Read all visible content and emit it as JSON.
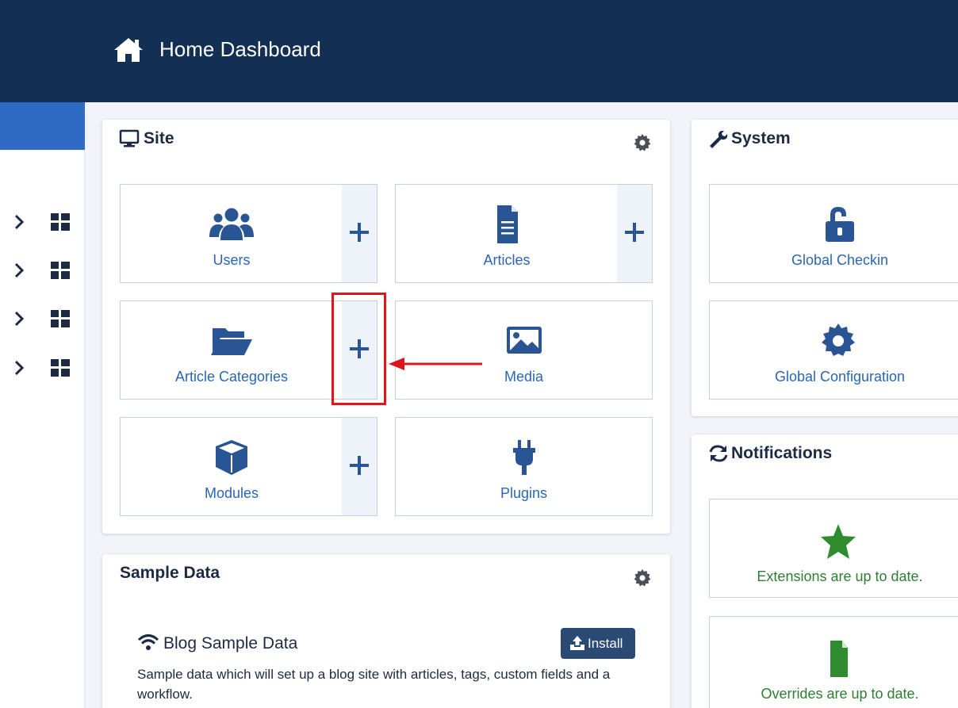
{
  "header": {
    "title": "Home Dashboard",
    "icon": "home-icon",
    "background": "#132f53"
  },
  "sidebar": {
    "active_color": "#2f6bc4",
    "rows": [
      {
        "chevron": "chevron-right-icon",
        "icon": "grid-icon"
      },
      {
        "chevron": "chevron-right-icon",
        "icon": "grid-icon"
      },
      {
        "chevron": "chevron-right-icon",
        "icon": "grid-icon"
      },
      {
        "chevron": "chevron-right-icon",
        "icon": "grid-icon"
      }
    ]
  },
  "site": {
    "title": "Site",
    "tiles": [
      {
        "label": "Users",
        "icon": "users-icon",
        "has_add": true
      },
      {
        "label": "Articles",
        "icon": "file-alt-icon",
        "has_add": true
      },
      {
        "label": "Article Categories",
        "icon": "folder-open-icon",
        "has_add": true
      },
      {
        "label": "Media",
        "icon": "image-icon",
        "has_add": false
      },
      {
        "label": "Modules",
        "icon": "cube-icon",
        "has_add": true
      },
      {
        "label": "Plugins",
        "icon": "plug-icon",
        "has_add": false
      }
    ]
  },
  "system": {
    "title": "System",
    "tiles": [
      {
        "label": "Global Checkin",
        "icon": "unlock-icon"
      },
      {
        "label": "Global Configuration",
        "icon": "cog-icon"
      }
    ]
  },
  "notifications": {
    "title": "Notifications",
    "tiles": [
      {
        "label": "Extensions are up to date.",
        "icon": "star-icon"
      },
      {
        "label": "Overrides are up to date.",
        "icon": "file-icon"
      }
    ],
    "status_color": "#2e7d32"
  },
  "sample_data": {
    "title": "Sample Data",
    "item_title": "Blog Sample Data",
    "description": "Sample data which will set up a blog site with articles, tags, custom fields and a workflow.",
    "install_label": "Install"
  },
  "annotation": {
    "color": "#e0141b"
  }
}
